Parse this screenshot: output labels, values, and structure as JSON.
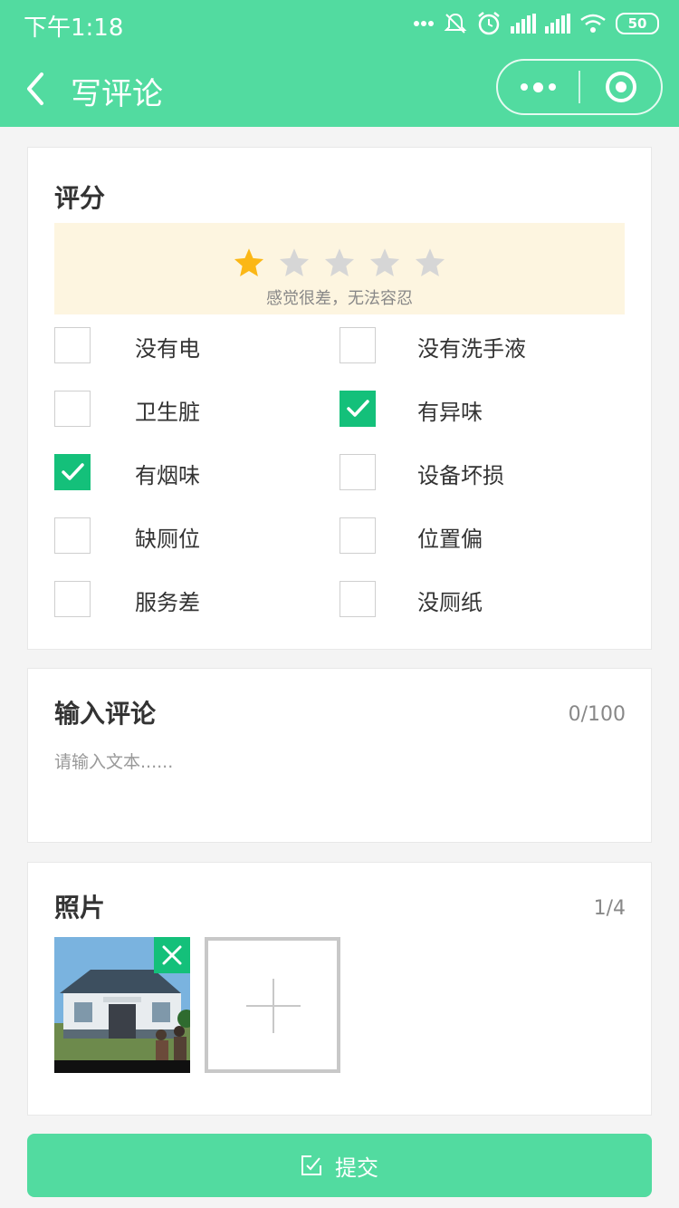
{
  "status_bar": {
    "time": "下午1:18",
    "battery": "50"
  },
  "nav": {
    "title": "写评论"
  },
  "rating": {
    "title": "评分",
    "stars_total": 5,
    "stars_filled": 1,
    "caption": "感觉很差，无法容忍"
  },
  "options": [
    {
      "label": "没有电",
      "checked": false
    },
    {
      "label": "没有洗手液",
      "checked": false
    },
    {
      "label": "卫生脏",
      "checked": false
    },
    {
      "label": "有异味",
      "checked": true
    },
    {
      "label": "有烟味",
      "checked": true
    },
    {
      "label": "设备坏损",
      "checked": false
    },
    {
      "label": "缺厕位",
      "checked": false
    },
    {
      "label": "位置偏",
      "checked": false
    },
    {
      "label": "服务差",
      "checked": false
    },
    {
      "label": "没厕纸",
      "checked": false
    }
  ],
  "comment": {
    "title": "输入评论",
    "count": "0/100",
    "placeholder": "请输入文本......"
  },
  "photos": {
    "title": "照片",
    "count": "1/4"
  },
  "submit": {
    "label": "提交"
  },
  "colors": {
    "brand": "#52dba0",
    "check": "#14c07a",
    "star_on": "#fbb716",
    "star_off": "#d6d6d6"
  }
}
